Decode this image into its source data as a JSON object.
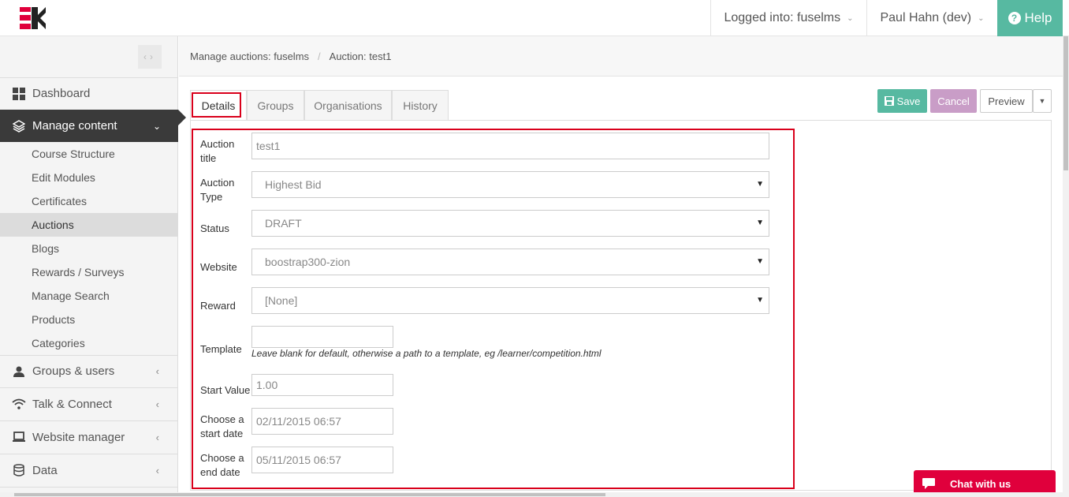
{
  "topbar": {
    "logged_into": "Logged into: fuselms",
    "user": "Paul Hahn (dev)",
    "help": "Help"
  },
  "sidebar": {
    "dashboard": "Dashboard",
    "manage_content": "Manage content",
    "sub_items": [
      "Course Structure",
      "Edit Modules",
      "Certificates",
      "Auctions",
      "Blogs",
      "Rewards / Surveys",
      "Manage Search",
      "Products",
      "Categories"
    ],
    "selected_sub_item": "Auctions",
    "groups_users": "Groups & users",
    "talk_connect": "Talk & Connect",
    "website_manager": "Website manager",
    "data": "Data"
  },
  "breadcrumb": {
    "parent": "Manage auctions: fuselms",
    "current": "Auction: test1"
  },
  "tabs": [
    "Details",
    "Groups",
    "Organisations",
    "History"
  ],
  "active_tab": "Details",
  "actions": {
    "save": "Save",
    "cancel": "Cancel",
    "preview": "Preview"
  },
  "form": {
    "auction_title_label": "Auction title",
    "auction_title_value": "test1",
    "auction_type_label": "Auction Type",
    "auction_type_value": "Highest Bid",
    "status_label": "Status",
    "status_value": "DRAFT",
    "website_label": "Website",
    "website_value": "boostrap300-zion",
    "reward_label": "Reward",
    "reward_value": "[None]",
    "template_label": "Template",
    "template_value": "",
    "template_help": "Leave blank for default, otherwise a path to a template, eg /learner/competition.html",
    "start_value_label": "Start Value",
    "start_value_value": "1.00",
    "start_date_label": "Choose a start date",
    "start_date_value": "02/11/2015 06:57",
    "end_date_label": "Choose a end date",
    "end_date_value": "05/11/2015 06:57"
  },
  "chat": {
    "label": "Chat with us"
  },
  "colors": {
    "accent_green": "#57b9a1",
    "cancel_purple": "#c99dc7",
    "highlight_red": "#d9001b",
    "chat_red": "#e0003c",
    "sidebar_active": "#3a3a3a"
  }
}
